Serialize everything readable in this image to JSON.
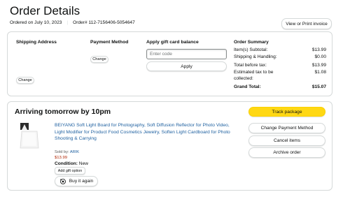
{
  "header": {
    "title": "Order Details",
    "ordered_on": "Ordered on July 10, 2023",
    "order_number": "Order# 112-7156406-5054647",
    "invoice_button": "View or Print invoice"
  },
  "details": {
    "shipping_heading": "Shipping Address",
    "shipping_change": "Change",
    "payment_heading": "Payment Method",
    "payment_change": "Change",
    "gift_heading": "Apply gift card balance",
    "gift_placeholder": "Enter code",
    "gift_apply": "Apply",
    "summary": {
      "heading": "Order Summary",
      "rows": [
        {
          "label": "Item(s) Subtotal:",
          "value": "$13.99"
        },
        {
          "label": "Shipping & Handling:",
          "value": "$0.00"
        },
        {
          "label": "Total before tax:",
          "value": "$13.99"
        },
        {
          "label": "Estimated tax to be collected:",
          "value": "$1.08"
        }
      ],
      "grand_total_label": "Grand Total:",
      "grand_total_value": "$15.07"
    }
  },
  "shipment": {
    "arriving": "Arriving tomorrow by 10pm",
    "product_title": "BEIYANG Soft Light Board for Photography, Soft Diffusion Reflector for Photo Video, Light Modifier for Product Food Cosmetics Jewelry, Soften Light Cardboard for Photo Shooting & Carrying",
    "sold_by_label": "Sold by: ",
    "sold_by_value": "ARIK",
    "price": "$13.99",
    "condition_label": "Condition:",
    "condition_value": " New",
    "add_gift_option": "Add gift option",
    "buy_again": "Buy it again",
    "actions": {
      "track": "Track package",
      "change_payment": "Change Payment Method",
      "cancel": "Cancel items",
      "archive": "Archive order"
    }
  },
  "colors": {
    "track_button": "#ffd814",
    "link": "#2162a1",
    "price": "#b12704"
  }
}
